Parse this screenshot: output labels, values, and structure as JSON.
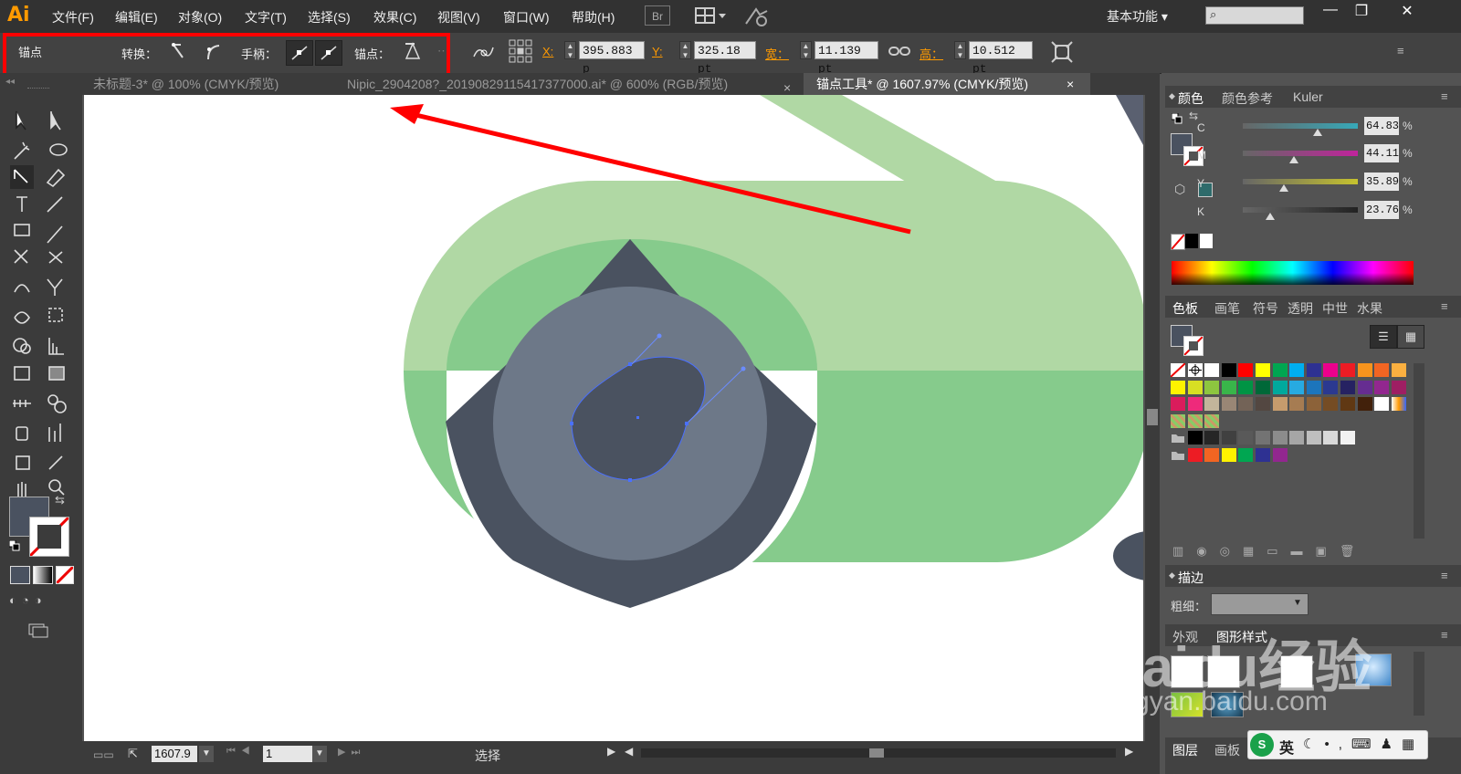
{
  "app": {
    "logo": "Ai",
    "workspace": "基本功能",
    "br": "Br"
  },
  "menu": [
    "文件(F)",
    "编辑(E)",
    "对象(O)",
    "文字(T)",
    "选择(S)",
    "效果(C)",
    "视图(V)",
    "窗口(W)",
    "帮助(H)"
  ],
  "window_controls": {
    "minimize": "—",
    "restore": "❐",
    "close": "✕"
  },
  "controlbar": {
    "tool_name": "锚点",
    "convert_label": "转换：",
    "handles_label": "手柄：",
    "anchors_label": "锚点：",
    "x_label": "X:",
    "x_value": "395.883 p",
    "y_label": "Y:",
    "y_value": "325.18 pt",
    "w_label": "宽：",
    "w_value": "11.139 pt",
    "h_label": "高：",
    "h_value": "10.512 pt"
  },
  "tabs": [
    {
      "label": "未标题-3* @ 100% (CMYK/预览)",
      "closable": false
    },
    {
      "label": "Nipic_2904208?_20190829115417377000.ai* @ 600% (RGB/预览)",
      "closable": true
    },
    {
      "label": "锚点工具* @ 1607.97% (CMYK/预览)",
      "closable": true,
      "active": true
    }
  ],
  "tab_close": "×",
  "statusbar": {
    "zoom": "1607.9",
    "page": "1",
    "mode": "选择"
  },
  "color_panel": {
    "tabs": [
      "颜色",
      "颜色参考",
      "Kuler"
    ],
    "sliders": [
      {
        "label": "C",
        "value": "64.83",
        "pct": 0.6483,
        "color": "#37a8b8"
      },
      {
        "label": "M",
        "value": "44.11",
        "pct": 0.4411,
        "color": "#c0249c"
      },
      {
        "label": "Y",
        "value": "35.89",
        "pct": 0.3589,
        "color": "#c6c22e"
      },
      {
        "label": "K",
        "value": "23.76",
        "pct": 0.2376,
        "color": "#222222"
      }
    ],
    "pct_sign": "%"
  },
  "swatches_panel": {
    "tabs": [
      "色板",
      "画笔",
      "符号",
      "透明",
      "中世",
      "水果"
    ]
  },
  "stroke_panel": {
    "title": "描边",
    "weight_label": "粗细："
  },
  "appearance_panel": {
    "tabs": [
      "外观",
      "图形样式"
    ]
  },
  "layers_panel": {
    "tabs": [
      "图层",
      "画板"
    ]
  },
  "watermark": {
    "brand": "Baidu经验",
    "url": "jingyan.baidu.com"
  },
  "ime": {
    "lang": "英"
  },
  "colors": {
    "fill": "#4a5260",
    "accent": "#ff9a00",
    "highlight": "#ff0000"
  }
}
